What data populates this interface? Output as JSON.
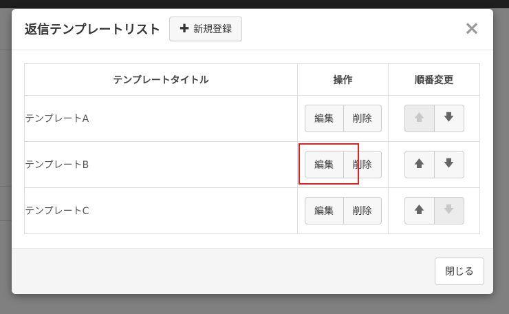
{
  "modal": {
    "title": "返信テンプレートリスト",
    "new_button": "新規登録",
    "close_icon": "×",
    "close_button": "閉じる"
  },
  "table": {
    "headers": {
      "title": "テンプレートタイトル",
      "ops": "操作",
      "order": "順番変更"
    },
    "rows": [
      {
        "name": "テンプレートA",
        "edit": "編集",
        "delete": "削除",
        "up_disabled": true,
        "down_disabled": false
      },
      {
        "name": "テンプレートB",
        "edit": "編集",
        "delete": "削除",
        "up_disabled": false,
        "down_disabled": false
      },
      {
        "name": "テンプレートC",
        "edit": "編集",
        "delete": "削除",
        "up_disabled": false,
        "down_disabled": true
      }
    ]
  },
  "icons": {
    "plus": "plus-icon",
    "close": "close-icon",
    "up": "arrow-up-icon",
    "down": "arrow-down-icon"
  },
  "colors": {
    "highlight": "#e02020",
    "backdrop": "#808080"
  }
}
